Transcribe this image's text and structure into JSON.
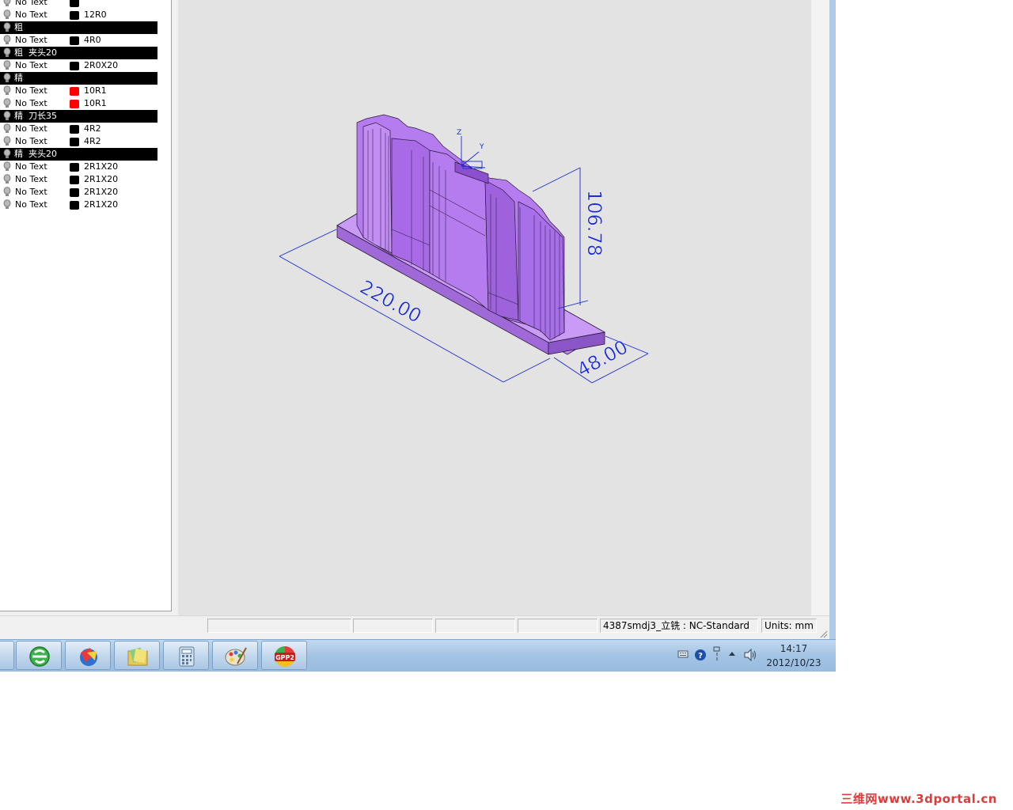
{
  "layers": {
    "rows": [
      {
        "kind": "item",
        "label": "No Text",
        "color": "#000000",
        "tool": ""
      },
      {
        "kind": "item",
        "label": "No Text",
        "color": "#000000",
        "tool": "12R0"
      },
      {
        "kind": "group",
        "label": "粗"
      },
      {
        "kind": "item",
        "label": "No Text",
        "color": "#000000",
        "tool": "4R0"
      },
      {
        "kind": "group",
        "label": "粗  夹头20"
      },
      {
        "kind": "item",
        "label": "No Text",
        "color": "#000000",
        "tool": "2R0X20"
      },
      {
        "kind": "group",
        "label": "精"
      },
      {
        "kind": "item",
        "label": "No Text",
        "color": "#ff0000",
        "tool": "10R1"
      },
      {
        "kind": "item",
        "label": "No Text",
        "color": "#ff0000",
        "tool": "10R1"
      },
      {
        "kind": "group",
        "label": "精  刀长35"
      },
      {
        "kind": "item",
        "label": "No Text",
        "color": "#000000",
        "tool": "4R2"
      },
      {
        "kind": "item",
        "label": "No Text",
        "color": "#000000",
        "tool": "4R2"
      },
      {
        "kind": "group",
        "label": "精  夹头20"
      },
      {
        "kind": "item",
        "label": "No Text",
        "color": "#000000",
        "tool": "2R1X20"
      },
      {
        "kind": "item",
        "label": "No Text",
        "color": "#000000",
        "tool": "2R1X20"
      },
      {
        "kind": "item",
        "label": "No Text",
        "color": "#000000",
        "tool": "2R1X20"
      },
      {
        "kind": "item",
        "label": "No Text",
        "color": "#000000",
        "tool": "2R1X20"
      }
    ]
  },
  "viewport": {
    "dimensions": {
      "width": "220.00",
      "height": "106.78",
      "depth": "48.00"
    },
    "axes": {
      "z": "Z",
      "y": "Y"
    },
    "model_color": "#b77ef0",
    "dim_color": "#1a2ad8"
  },
  "statusbar": {
    "document": "4387smdj3_立铣 : NC-Standard",
    "units": "Units: mm"
  },
  "taskbar": {
    "apps": [
      "ie-icon",
      "app-globe-icon",
      "folder-icon",
      "calculator-icon",
      "paint-icon",
      "gpp2-icon"
    ],
    "gpp_label": "GPP2",
    "time": "14:17",
    "date": "2012/10/23"
  },
  "watermark": "三维网www.3dportal.cn"
}
